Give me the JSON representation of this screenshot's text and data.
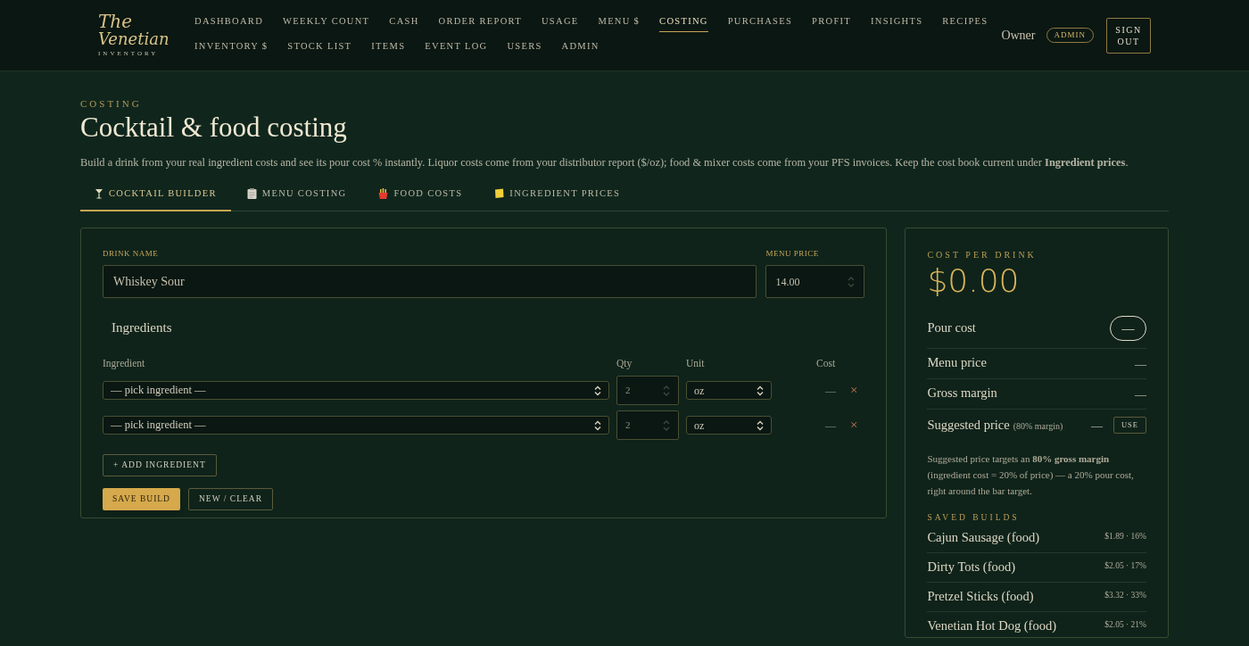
{
  "logo": {
    "line_1": "The",
    "line_2": "Venetian",
    "subtitle": "INVENTORY"
  },
  "nav": {
    "rows": [
      [
        {
          "label": "DASHBOARD",
          "selected": false
        },
        {
          "label": "WEEKLY COUNT",
          "selected": false
        },
        {
          "label": "CASH",
          "selected": false
        },
        {
          "label": "ORDER REPORT",
          "selected": false
        },
        {
          "label": "USAGE",
          "selected": false
        },
        {
          "label": "MENU $",
          "selected": false
        },
        {
          "label": "COSTING",
          "selected": true
        },
        {
          "label": "PURCHASES",
          "selected": false
        },
        {
          "label": "PROFIT",
          "selected": false
        },
        {
          "label": "INSIGHTS",
          "selected": false
        },
        {
          "label": "RECIPES",
          "selected": false
        }
      ],
      [
        {
          "label": "INVENTORY $",
          "selected": false
        },
        {
          "label": "STOCK LIST",
          "selected": false
        },
        {
          "label": "ITEMS",
          "selected": false
        },
        {
          "label": "EVENT LOG",
          "selected": false
        },
        {
          "label": "USERS",
          "selected": false
        },
        {
          "label": "ADMIN",
          "selected": false
        }
      ]
    ]
  },
  "user": {
    "name": "Owner",
    "role_badge": "ADMIN",
    "sign_out": "SIGN OUT"
  },
  "page": {
    "eyebrow": "COSTING",
    "title": "Cocktail & food costing",
    "description": "Build a drink from your real ingredient costs and see its pour cost % instantly. Liquor costs come from your distributor report ($/oz); food & mixer costs come from your PFS invoices. Keep the cost book current under **Ingredient prices**."
  },
  "tabs": [
    {
      "label": "COCKTAIL BUILDER",
      "selected": true
    },
    {
      "label": "MENU COSTING",
      "selected": false
    },
    {
      "label": "FOOD COSTS",
      "selected": false
    },
    {
      "label": "INGREDIENT PRICES",
      "selected": false
    }
  ],
  "builder": {
    "drink_name": {
      "label": "DRINK NAME",
      "value": "Whiskey Sour"
    },
    "menu_price": {
      "label": "MENU PRICE",
      "value": "14.00"
    },
    "ingredients_title": "Ingredients",
    "columns": [
      "Ingredient",
      "Qty",
      "Unit",
      "Cost"
    ],
    "rows": [
      {
        "ingredient": "— pick ingredient —",
        "qty": "2",
        "unit": "oz",
        "cost": "—",
        "remove": "×"
      },
      {
        "ingredient": "— pick ingredient —",
        "qty": "2",
        "unit": "oz",
        "cost": "—",
        "remove": "×"
      }
    ],
    "add_button": "+ ADD INGREDIENT",
    "save_button": "SAVE BUILD",
    "clear_button": "NEW / CLEAR"
  },
  "summary": {
    "eyebrow": "COST PER DRINK",
    "cost": "$0.00",
    "metrics": [
      {
        "kind": "pill",
        "label": "Pour cost",
        "value": "—"
      },
      {
        "kind": "plain",
        "label": "Menu price",
        "value": "—"
      },
      {
        "kind": "plain",
        "label": "Gross margin",
        "value": "—"
      },
      {
        "kind": "action",
        "label": "Suggested price",
        "note": "(80% margin)",
        "value": "—",
        "button": "USE"
      }
    ],
    "explanation": "Suggested price targets an **80% gross margin** (ingredient cost = 20% of price) — a 20% pour cost, right around the bar target.",
    "saved_title": "SAVED BUILDS",
    "saved_builds": [
      {
        "name": "Cajun Sausage (food)",
        "stats": "$1.89 · 16%"
      },
      {
        "name": "Dirty Tots (food)",
        "stats": "$2.05 · 17%"
      },
      {
        "name": "Pretzel Sticks (food)",
        "stats": "$3.32 · 33%"
      },
      {
        "name": "Venetian Hot Dog (food)",
        "stats": "$2.05 · 21%"
      }
    ]
  }
}
